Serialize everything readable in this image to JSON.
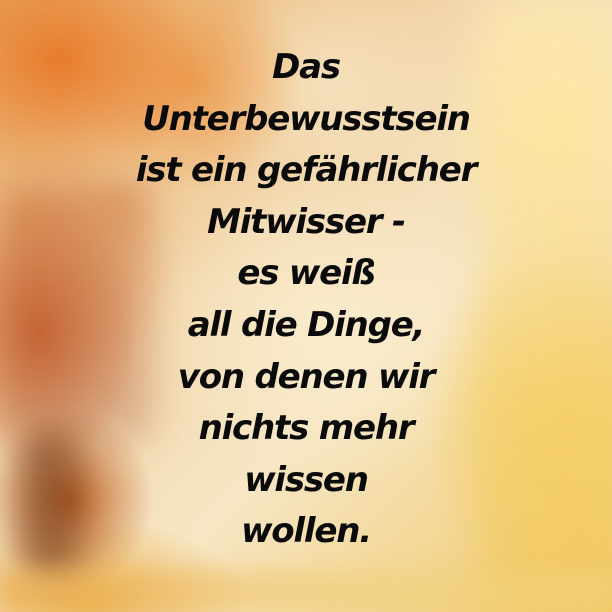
{
  "quote": {
    "lines": [
      "Das",
      "Unterbewusstsein",
      "ist ein gefährlicher",
      "Mitwisser -",
      "es weiß",
      "all die Dinge,",
      "von denen wir",
      "nichts mehr",
      "wissen",
      "wollen."
    ]
  }
}
